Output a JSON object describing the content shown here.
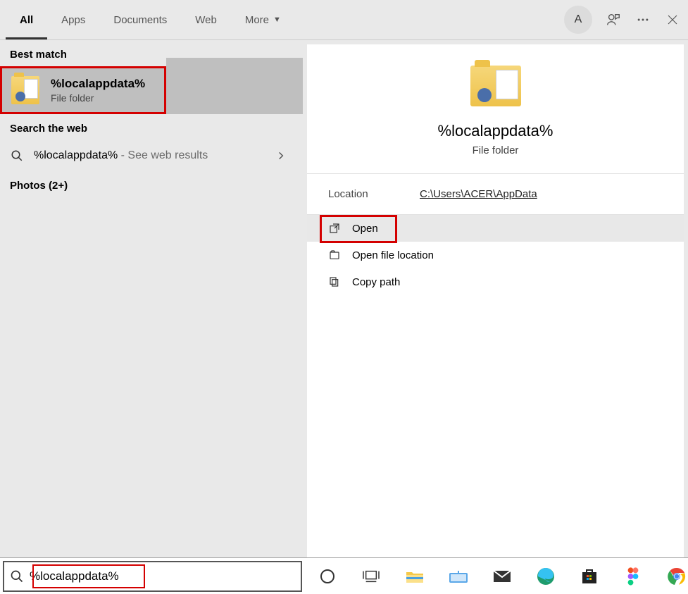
{
  "header": {
    "tabs": {
      "all": "All",
      "apps": "Apps",
      "documents": "Documents",
      "web": "Web",
      "more": "More"
    },
    "avatar_initial": "A"
  },
  "left": {
    "best_match_label": "Best match",
    "best_match": {
      "title": "%localappdata%",
      "subtitle": "File folder"
    },
    "search_web_label": "Search the web",
    "web_item": {
      "query": "%localappdata%",
      "suffix": " - See web results"
    },
    "photos_label": "Photos (2+)"
  },
  "right": {
    "title": "%localappdata%",
    "subtitle": "File folder",
    "location_label": "Location",
    "location_value": "C:\\Users\\ACER\\AppData",
    "actions": {
      "open": "Open",
      "open_location": "Open file location",
      "copy_path": "Copy path"
    }
  },
  "taskbar": {
    "search_value": "%localappdata%"
  }
}
